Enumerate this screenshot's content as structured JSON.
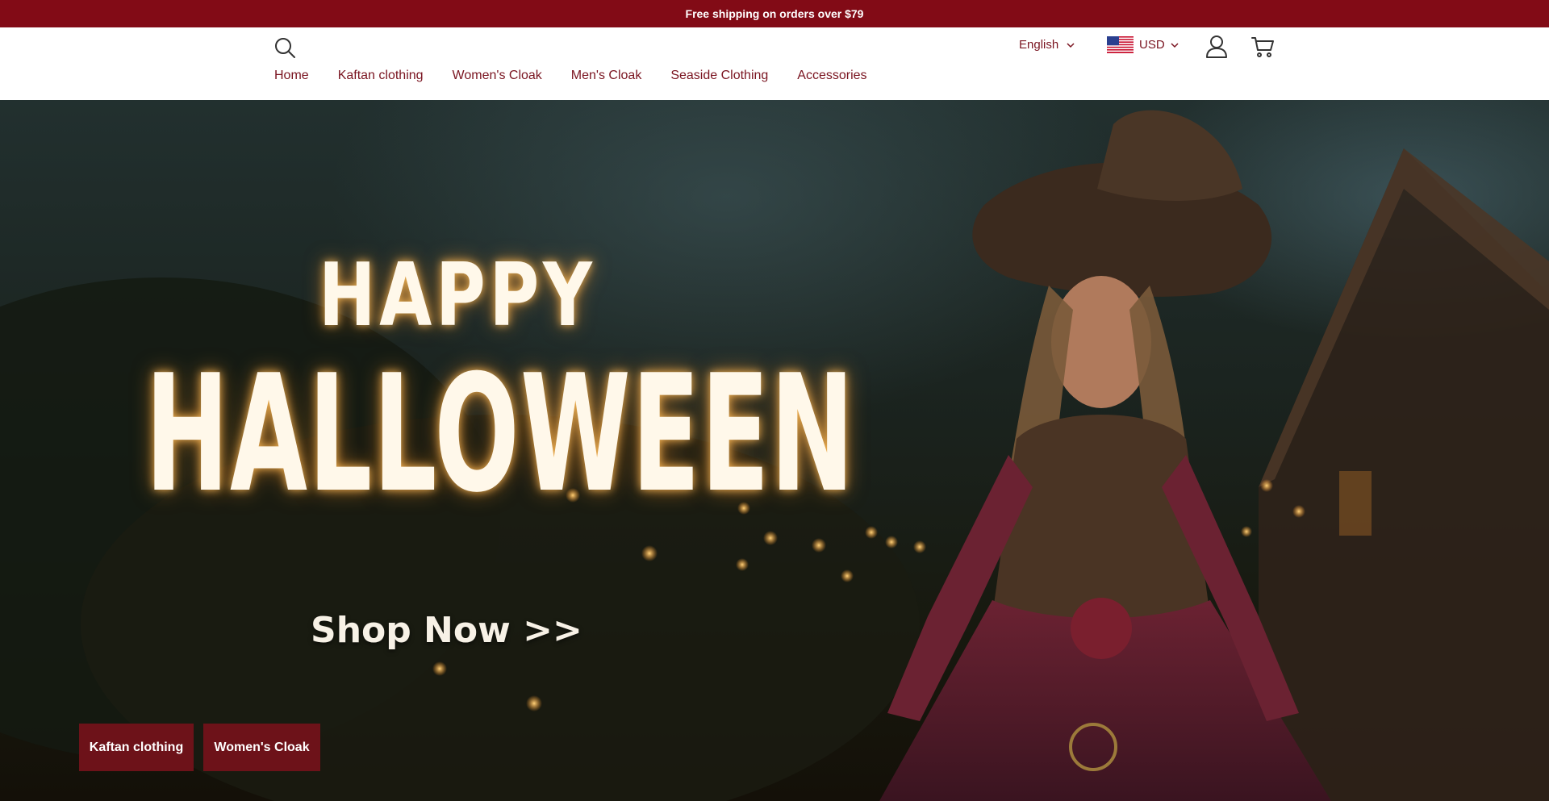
{
  "announcement": {
    "text": "Free shipping on orders over $79"
  },
  "header": {
    "search_icon": "search-icon",
    "nav": [
      {
        "label": "Home"
      },
      {
        "label": "Kaftan clothing"
      },
      {
        "label": "Women's Cloak"
      },
      {
        "label": "Men's Cloak"
      },
      {
        "label": "Seaside Clothing"
      },
      {
        "label": "Accessories"
      }
    ],
    "language": "English",
    "currency": "USD",
    "flag_icon": "us-flag-icon",
    "account_icon": "user-icon",
    "cart_icon": "cart-icon"
  },
  "hero": {
    "title_line1": "HAPPY",
    "title_line2": "HALLOWEEN",
    "cta": "Shop Now >>",
    "category_buttons": [
      {
        "label": "Kaftan clothing"
      },
      {
        "label": "Women's Cloak"
      }
    ]
  },
  "colors": {
    "brand": "#820b16",
    "nav_text": "#7a1420",
    "button_bg": "#6d1219",
    "hero_glow": "#ffbe5a"
  }
}
